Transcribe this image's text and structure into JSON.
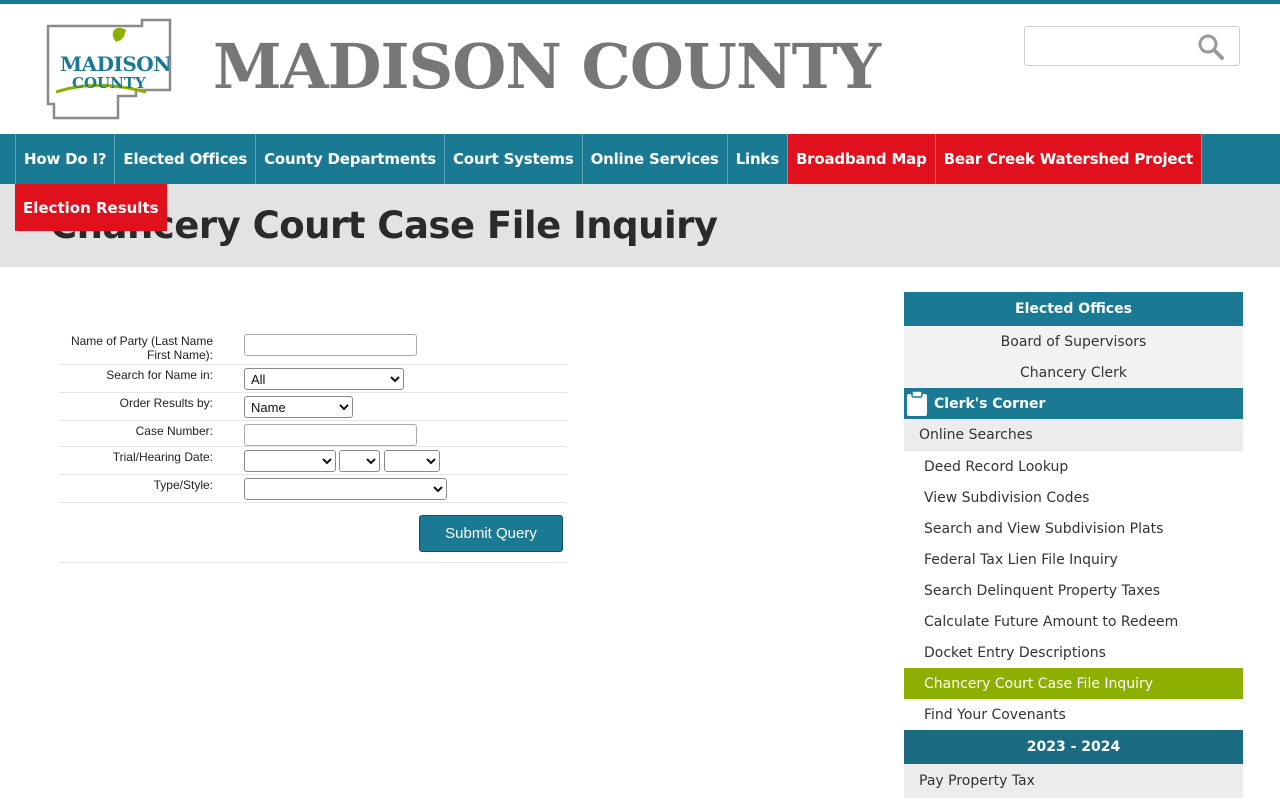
{
  "header": {
    "site_title": "MADISON COUNTY",
    "logo_text_line1": "MADISON",
    "logo_text_line2": "COUNTY",
    "search_placeholder": ""
  },
  "nav": {
    "items": [
      {
        "label": "How Do I?",
        "style": "normal"
      },
      {
        "label": "Elected Offices",
        "style": "normal"
      },
      {
        "label": "County Departments",
        "style": "normal"
      },
      {
        "label": "Court Systems",
        "style": "normal"
      },
      {
        "label": "Online Services",
        "style": "normal"
      },
      {
        "label": "Links",
        "style": "normal"
      },
      {
        "label": "Broadband Map",
        "style": "red"
      },
      {
        "label": "Bear Creek Watershed Project",
        "style": "red"
      }
    ],
    "overflow_item": "Election Results"
  },
  "page": {
    "title": "Chancery Court Case File Inquiry"
  },
  "form": {
    "name_label": "Name of Party (Last Name First Name):",
    "name_value": "",
    "search_in_label": "Search for Name in:",
    "search_in_value": "All",
    "order_label": "Order Results by:",
    "order_value": "Name",
    "case_number_label": "Case Number:",
    "case_number_value": "",
    "date_label": "Trial/Hearing Date:",
    "type_label": "Type/Style:",
    "submit_label": "Submit Query"
  },
  "sidebar": {
    "heading": "Elected Offices",
    "offices": [
      "Board of Supervisors",
      "Chancery Clerk"
    ],
    "clerks_corner": "Clerk's Corner",
    "online_searches": "Online Searches",
    "links": [
      "Deed Record Lookup",
      "View Subdivision Codes",
      "Search and View Subdivision Plats",
      "Federal Tax Lien File Inquiry",
      "Search Delinquent Property Taxes",
      "Calculate Future Amount to Redeem",
      "Docket Entry Descriptions",
      "Chancery Court Case File Inquiry",
      "Find Your Covenants"
    ],
    "active_link_index": 7,
    "year_heading": "2023 - 2024",
    "pay_tax": "Pay Property Tax"
  },
  "colors": {
    "primary": "#1a7a94",
    "alert_red": "#e0101c",
    "active_green": "#8db000",
    "title_gray": "#777777"
  }
}
